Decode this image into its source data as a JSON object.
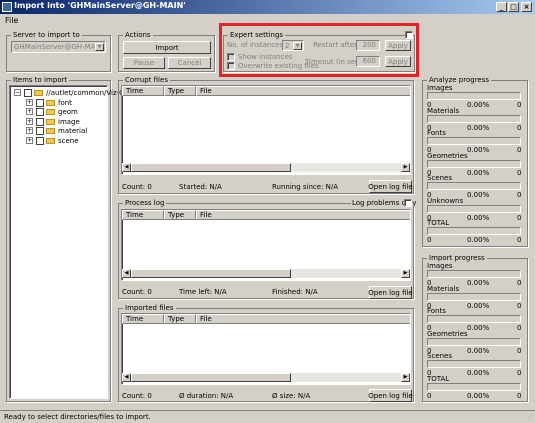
{
  "window": {
    "title": "Import into 'GHMainServer@GH-MAIN'",
    "minimize": "_",
    "maximize": "□",
    "close": "×"
  },
  "menu": {
    "file": "File"
  },
  "server": {
    "group_label": "Server to import to",
    "combo_value": "GHMainServer@GH-MAIN(Adr"
  },
  "actions": {
    "group_label": "Actions",
    "import": "Import",
    "pause": "Pause",
    "cancel": "Cancel"
  },
  "expert": {
    "group_label": "Expert settings",
    "num_instances_label": "No. of instances:",
    "num_instances_value": "2",
    "restart_after_label": "Restart after:",
    "restart_after_value": "200",
    "apply1": "Apply",
    "show_instances": "Show instances",
    "timeout_label": "Timeout (in sec.):",
    "timeout_value": "600",
    "apply2": "Apply",
    "overwrite": "Overwrite existing files"
  },
  "items": {
    "group_label": "Items to import",
    "root": "//autlet/common/Viz-C",
    "children": [
      "font",
      "geom",
      "image",
      "material",
      "scene"
    ]
  },
  "corrupt": {
    "group_label": "Corrupt files",
    "columns": [
      "Time",
      "Type",
      "File"
    ],
    "count": "Count: 0",
    "started": "Started: N/A",
    "running": "Running since: N/A",
    "open_log": "Open log file"
  },
  "process": {
    "group_label": "Process log",
    "log_problems": "Log problems only",
    "columns": [
      "Time",
      "Type",
      "File"
    ],
    "count": "Count: 0",
    "time_left": "Time left: N/A",
    "finished": "Finished: N/A",
    "open_log": "Open log file"
  },
  "imported": {
    "group_label": "Imported files",
    "columns": [
      "Time",
      "Type",
      "File"
    ],
    "count": "Count: 0",
    "duration": "Ø duration: N/A",
    "size": "Ø size: N/A",
    "open_log": "Open log file"
  },
  "analyze": {
    "group_label": "Analyze progress",
    "rows": [
      {
        "label": "Images",
        "left": "0",
        "pct": "0.00%",
        "right": "0"
      },
      {
        "label": "Materials",
        "left": "0",
        "pct": "0.00%",
        "right": "0"
      },
      {
        "label": "Fonts",
        "left": "0",
        "pct": "0.00%",
        "right": "0"
      },
      {
        "label": "Geometries",
        "left": "0",
        "pct": "0.00%",
        "right": "0"
      },
      {
        "label": "Scenes",
        "left": "0",
        "pct": "0.00%",
        "right": "0"
      },
      {
        "label": "Unknowns",
        "left": "0",
        "pct": "0.00%",
        "right": "0"
      },
      {
        "label": "TOTAL",
        "left": "0",
        "pct": "0.00%",
        "right": "0"
      }
    ]
  },
  "import_progress": {
    "group_label": "Import progress",
    "rows": [
      {
        "label": "Images",
        "left": "0",
        "pct": "0.00%",
        "right": "0"
      },
      {
        "label": "Materials",
        "left": "0",
        "pct": "0.00%",
        "right": "0"
      },
      {
        "label": "Fonts",
        "left": "0",
        "pct": "0.00%",
        "right": "0"
      },
      {
        "label": "Geometries",
        "left": "0",
        "pct": "0.00%",
        "right": "0"
      },
      {
        "label": "Scenes",
        "left": "0",
        "pct": "0.00%",
        "right": "0"
      },
      {
        "label": "TOTAL",
        "left": "0",
        "pct": "0.00%",
        "right": "0"
      }
    ]
  },
  "status": {
    "text": "Ready to select directories/files to import."
  },
  "colors": {
    "highlight": "#e8202a",
    "titlebar": "#0a246a"
  }
}
